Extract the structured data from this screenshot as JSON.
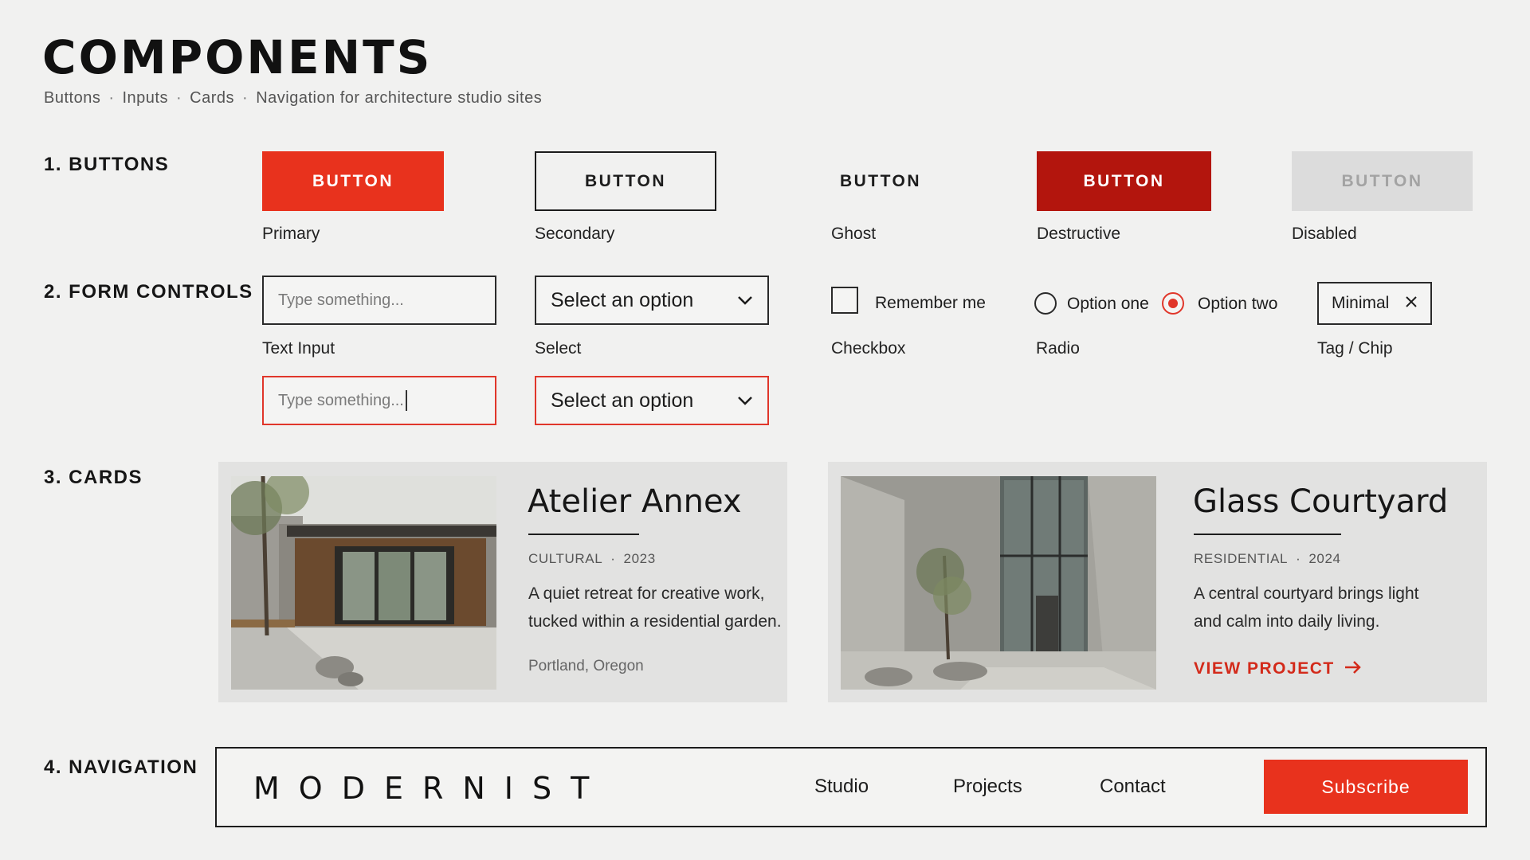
{
  "header": {
    "title": "COMPONENTS",
    "subtitle_parts": [
      "Buttons",
      "Inputs",
      "Cards",
      "Navigation for architecture studio sites"
    ]
  },
  "sections": {
    "buttons": "1. BUTTONS",
    "forms": "2. FORM CONTROLS",
    "cards": "3. CARDS",
    "navigation": "4. NAVIGATION"
  },
  "buttons": [
    {
      "label": "BUTTON",
      "caption": "Primary"
    },
    {
      "label": "BUTTON",
      "caption": "Secondary"
    },
    {
      "label": "BUTTON",
      "caption": "Ghost"
    },
    {
      "label": "BUTTON",
      "caption": "Destructive"
    },
    {
      "label": "BUTTON",
      "caption": "Disabled"
    }
  ],
  "forms": {
    "text_input": {
      "placeholder": "Type something...",
      "caption": "Text Input",
      "error_value": "Type something..."
    },
    "select": {
      "value": "Select an option",
      "caption": "Select"
    },
    "checkbox": {
      "label": "Remember me",
      "caption": "Checkbox",
      "checked": false
    },
    "radio": {
      "options": [
        "Option one",
        "Option two"
      ],
      "selected": "Option two",
      "caption": "Radio"
    },
    "chip": {
      "label": "Minimal",
      "caption": "Tag / Chip"
    }
  },
  "cards": [
    {
      "title": "Atelier Annex",
      "category": "CULTURAL",
      "year": "2023",
      "desc_line1": "A quiet retreat for creative work,",
      "desc_line2": "tucked within a residential garden.",
      "location": "Portland, Oregon"
    },
    {
      "title": "Glass Courtyard",
      "category": "RESIDENTIAL",
      "year": "2024",
      "desc_line1": "A central courtyard brings light",
      "desc_line2": "and calm into daily living.",
      "link": "VIEW PROJECT"
    }
  ],
  "nav": {
    "brand": "MODERNIST",
    "links": [
      "Studio",
      "Projects",
      "Contact"
    ],
    "cta": "Subscribe"
  },
  "colors": {
    "primary": "#e8321d",
    "destructive": "#b3150d",
    "disabled_bg": "#dcdcdc",
    "error": "#e0362a",
    "background": "#f1f1f0",
    "card_bg": "#e2e2e1"
  },
  "icons": [
    "chevron-down-icon",
    "close-icon",
    "arrow-right-icon"
  ]
}
